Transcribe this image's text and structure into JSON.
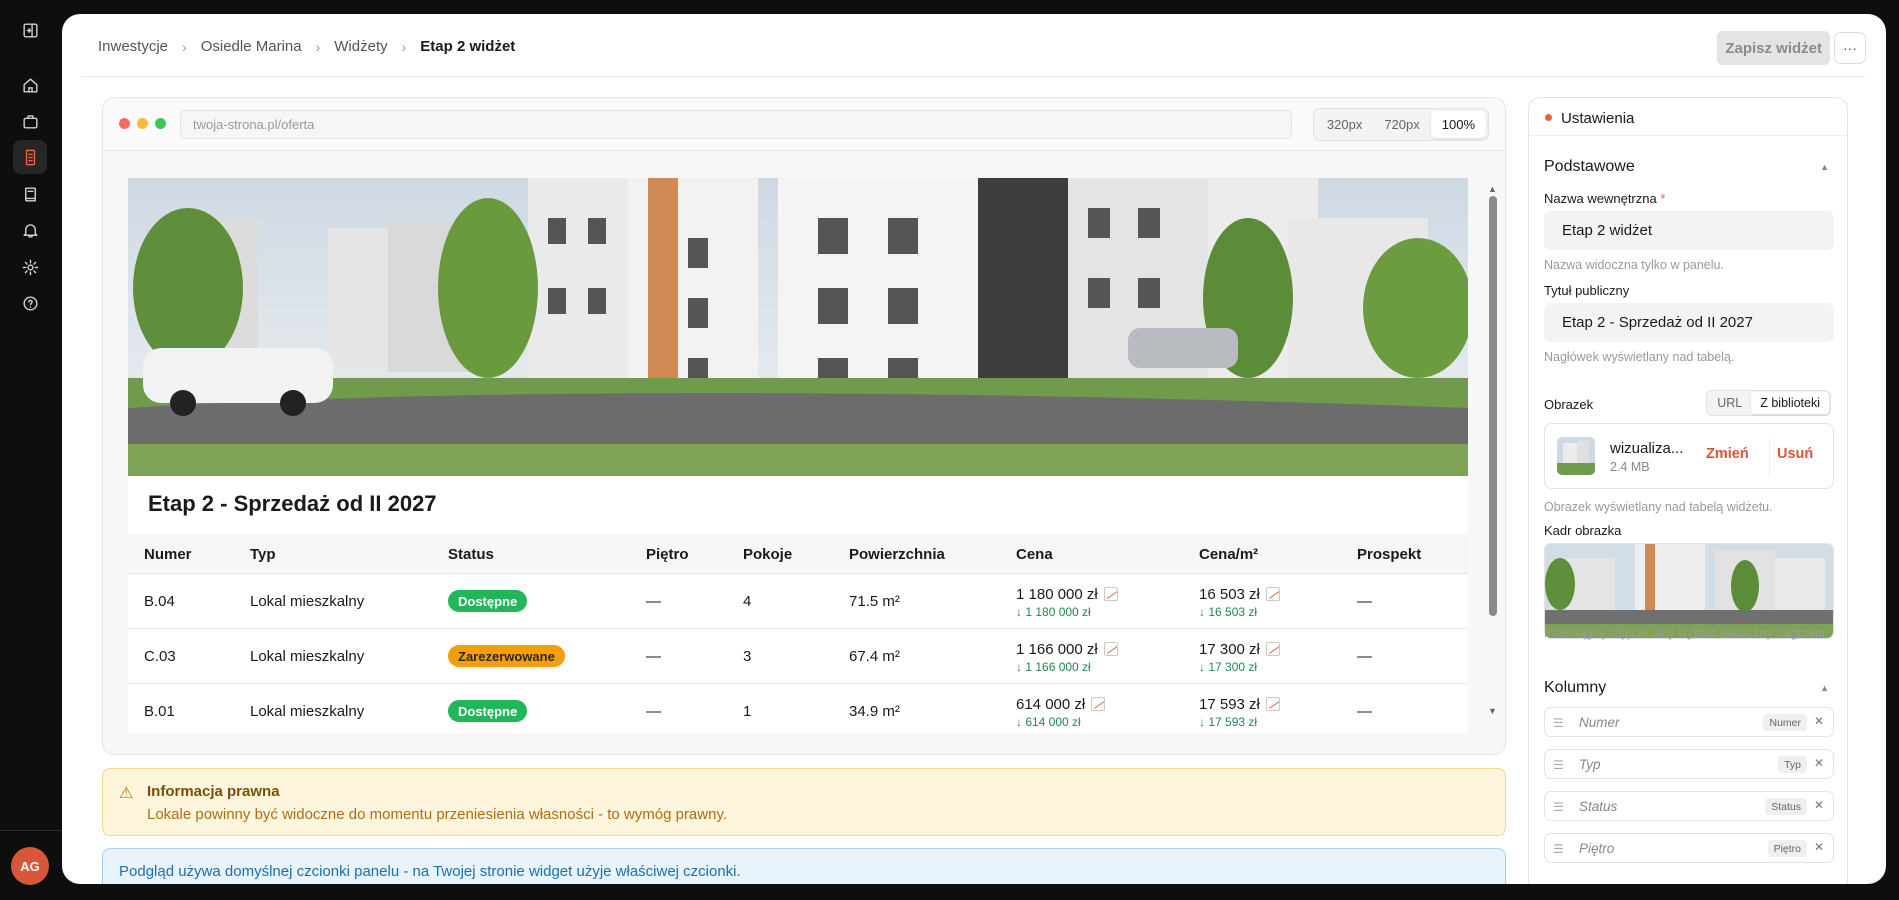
{
  "breadcrumbs": [
    "Inwestycje",
    "Osiedle Marina",
    "Widżety",
    "Etap 2 widżet"
  ],
  "header": {
    "save_label": "Zapisz widżet",
    "more_label": "···"
  },
  "user": {
    "initials": "AG"
  },
  "rail_icons": [
    "sidebar-toggle-icon",
    "home-icon",
    "briefcase-icon",
    "building-icon",
    "book-icon",
    "bell-icon",
    "gear-icon",
    "help-icon"
  ],
  "preview": {
    "url": "twoja-strona.pl/oferta",
    "sizes": [
      "320px",
      "720px",
      "100%"
    ],
    "active_size": "100%"
  },
  "widget": {
    "title": "Etap 2 - Sprzedaż od II 2027",
    "columns": [
      "Numer",
      "Typ",
      "Status",
      "Piętro",
      "Pokoje",
      "Powierzchnia",
      "Cena",
      "Cena/m²",
      "Prospekt"
    ],
    "rows": [
      {
        "numer": "B.04",
        "typ": "Lokal mieszkalny",
        "status": "Dostępne",
        "pietro": "—",
        "pokoje": "4",
        "powierzchnia": "71.5 m²",
        "cena": "1 180 000 zł",
        "cena_sub": "↓ 1 180 000 zł",
        "cena_m2": "16 503 zł",
        "cena_m2_sub": "↓ 16 503 zł",
        "prospekt": "—"
      },
      {
        "numer": "C.03",
        "typ": "Lokal mieszkalny",
        "status": "Zarezerwowane",
        "pietro": "—",
        "pokoje": "3",
        "powierzchnia": "67.4 m²",
        "cena": "1 166 000 zł",
        "cena_sub": "↓ 1 166 000 zł",
        "cena_m2": "17 300 zł",
        "cena_m2_sub": "↓ 17 300 zł",
        "prospekt": "—"
      },
      {
        "numer": "B.01",
        "typ": "Lokal mieszkalny",
        "status": "Dostępne",
        "pietro": "—",
        "pokoje": "1",
        "powierzchnia": "34.9 m²",
        "cena": "614 000 zł",
        "cena_sub": "↓ 614 000 zł",
        "cena_m2": "17 593 zł",
        "cena_m2_sub": "↓ 17 593 zł",
        "prospekt": "—"
      }
    ]
  },
  "notices": {
    "legal_title": "Informacja prawna",
    "legal_text": "Lokale powinny być widoczne do momentu przeniesienia własności - to wymóg prawny.",
    "info_text": "Podgląd używa domyślnej czcionki panelu - na Twojej stronie widget użyje właściwej czcionki."
  },
  "settings": {
    "title": "Ustawienia",
    "section_basic": "Podstawowe",
    "name_label": "Nazwa wewnętrzna",
    "name_required": "*",
    "name_value": "Etap 2 widżet",
    "name_hint": "Nazwa widoczna tylko w panelu.",
    "public_title_label": "Tytuł publiczny",
    "public_title_value": "Etap 2 - Sprzedaż od II 2027",
    "public_title_hint": "Nagłówek wyświetlany nad tabelą.",
    "image_label": "Obrazek",
    "image_modes": [
      "URL",
      "Z biblioteki"
    ],
    "image_mode_active": "Z biblioteki",
    "file_name": "wizualiza...",
    "file_size": "2.4 MB",
    "change_label": "Zmień",
    "remove_label": "Usuń",
    "image_hint": "Obrazek wyświetlany nad tabelą widżetu.",
    "crop_label": "Kadr obrazka",
    "crop_hint": "Przeciągnij zdjęcie, aby wybrać widoczny fragment.",
    "section_columns": "Kolumny",
    "columns": [
      {
        "name": "Numer",
        "tag": "Numer"
      },
      {
        "name": "Typ",
        "tag": "Typ"
      },
      {
        "name": "Status",
        "tag": "Status"
      },
      {
        "name": "Piętro",
        "tag": "Piętro"
      }
    ]
  },
  "colors": {
    "accent": "#e8623a",
    "available": "#22b55a",
    "reserved": "#f59e0b"
  }
}
